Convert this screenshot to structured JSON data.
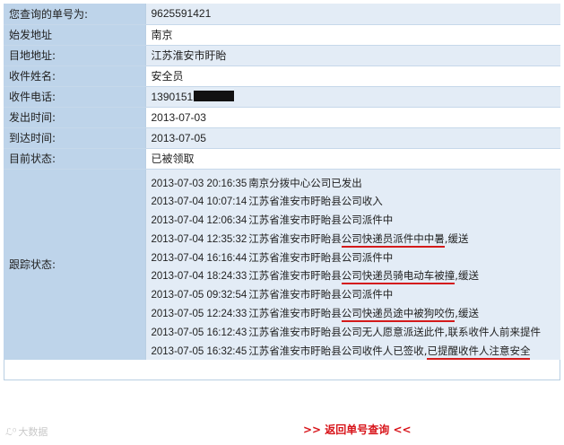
{
  "rows": [
    {
      "key": "tracking_no",
      "label": "您查询的单号为:",
      "value": "9625591421"
    },
    {
      "key": "origin",
      "label": "始发地址",
      "value": "南京"
    },
    {
      "key": "destination",
      "label": "目地地址:",
      "value": "江苏淮安市盱眙"
    },
    {
      "key": "recipient",
      "label": "收件姓名:",
      "value": "安全员"
    },
    {
      "key": "phone",
      "label": "收件电话:",
      "value": "1390151"
    },
    {
      "key": "sent",
      "label": "发出时间:",
      "value": "2013-07-03"
    },
    {
      "key": "arrived",
      "label": "到达时间:",
      "value": "2013-07-05"
    },
    {
      "key": "status",
      "label": "目前状态:",
      "value": "已被领取"
    }
  ],
  "tracking": {
    "label": "跟踪状态:",
    "events": [
      {
        "time": "2013-07-03 20:16:35",
        "pre": "南京分拨中心公司已发出",
        "mark": "",
        "post": ""
      },
      {
        "time": "2013-07-04 10:07:14",
        "pre": "江苏省淮安市盱眙县公司收入",
        "mark": "",
        "post": ""
      },
      {
        "time": "2013-07-04 12:06:34",
        "pre": "江苏省淮安市盱眙县公司派件中",
        "mark": "",
        "post": ""
      },
      {
        "time": "2013-07-04 12:35:32",
        "pre": "江苏省淮安市盱眙县",
        "mark": "公司快递员派件中中暑",
        "post": ",缓送"
      },
      {
        "time": "2013-07-04 16:16:44",
        "pre": "江苏省淮安市盱眙县公司派件中",
        "mark": "",
        "post": ""
      },
      {
        "time": "2013-07-04 18:24:33",
        "pre": "江苏省淮安市盱眙县",
        "mark": "公司快递员骑电动车被撞",
        "post": ",缓送"
      },
      {
        "time": "2013-07-05 09:32:54",
        "pre": "江苏省淮安市盱眙县公司派件中",
        "mark": "",
        "post": ""
      },
      {
        "time": "2013-07-05 12:24:33",
        "pre": "江苏省淮安市盱眙县",
        "mark": "公司快递员途中被狗咬伤",
        "post": ",缓送"
      },
      {
        "time": "2013-07-05 16:12:43",
        "pre": "江苏省淮安市盱眙县公司无人愿意派送此件,联系收件人前来提件",
        "mark": "",
        "post": ""
      },
      {
        "time": "2013-07-05 16:32:45",
        "pre": "江苏省淮安市盱眙县公司收件人已签收,",
        "mark": "已提醒收件人注意安全",
        "post": ""
      }
    ]
  },
  "footer": {
    "back_link": ">> 返回单号查询 <<"
  },
  "watermark": {
    "text": "大数据"
  },
  "colors": {
    "label_bg": "#bed4ea",
    "alt_row_bg": "#e3ecf6",
    "status_red": "#c8151b",
    "underline_red": "#d41a1a"
  }
}
